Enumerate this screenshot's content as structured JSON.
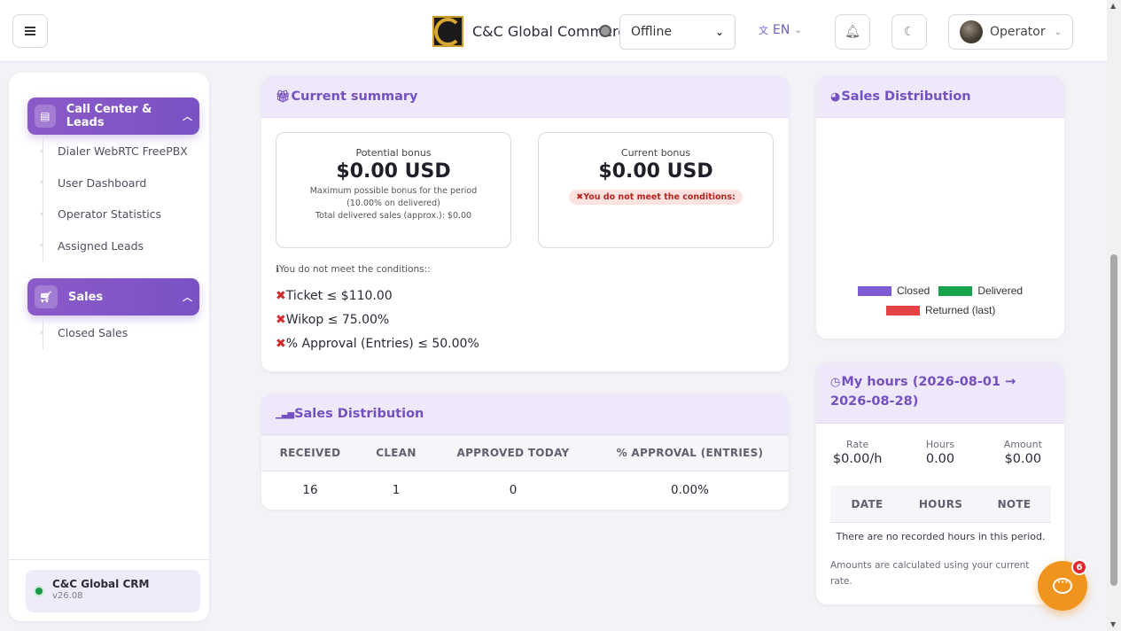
{
  "header": {
    "menu_icon": "hamburger-icon",
    "brand_name": "C&C Global Commerce FZ LLC",
    "status_select_value": "Offline",
    "language": "EN",
    "language_icon": "translate-icon",
    "notifications_icon": "bell-icon",
    "theme_icon": "moon-icon",
    "user_name": "Operator"
  },
  "sidebar": {
    "sections": [
      {
        "title": "Call Center & Leads",
        "icon": "table-icon",
        "items": [
          "Dialer WebRTC FreePBX",
          "User Dashboard",
          "Operator Statistics",
          "Assigned Leads"
        ]
      },
      {
        "title": "Sales",
        "icon": "cart-icon",
        "items": [
          "Closed Sales"
        ]
      }
    ],
    "footer": {
      "name": "C&C Global CRM",
      "version": "v26.08",
      "status_color": "#1c9a4a"
    }
  },
  "summary": {
    "title": "Current summary",
    "title_icon": "gift-icon",
    "potential": {
      "label": "Potential bonus",
      "value": "$0.00 USD",
      "note_line1": "Maximum possible bonus for the period",
      "note_line2": "(10.00% on delivered)",
      "note_line3": "Total delivered sales (approx.): $0.00"
    },
    "current": {
      "label": "Current bonus",
      "value": "$0.00 USD",
      "warning": "You do not meet the conditions:"
    },
    "conditions_title": "You do not meet the conditions::",
    "conditions": [
      "Ticket ≤ $110.00",
      "Wikop ≤ 75.00%",
      "% Approval (Entries) ≤ 50.00%"
    ]
  },
  "distribution_table": {
    "title": "Sales Distribution",
    "title_icon": "bar-chart-icon",
    "columns": [
      "RECEIVED",
      "CLEAN",
      "APPROVED TODAY",
      "% APPROVAL (ENTRIES)"
    ],
    "row": [
      "16",
      "1",
      "0",
      "0.00%"
    ]
  },
  "distribution_chart": {
    "title": "Sales Distribution",
    "title_icon": "pie-chart-icon",
    "legend": [
      {
        "label": "Closed",
        "color": "#7e5bd0"
      },
      {
        "label": "Delivered",
        "color": "#16a34a"
      },
      {
        "label": "Returned (last)",
        "color": "#e54343"
      }
    ]
  },
  "hours": {
    "title": "My hours (2026-08-01 → 2026-08-28)",
    "title_icon": "clock-icon",
    "stats": [
      {
        "label": "Rate",
        "value": "$0.00/h"
      },
      {
        "label": "Hours",
        "value": "0.00"
      },
      {
        "label": "Amount",
        "value": "$0.00"
      }
    ],
    "columns": [
      "DATE",
      "HOURS",
      "NOTE"
    ],
    "empty_message": "There are no recorded hours in this period.",
    "note": "Amounts are calculated using your current rate."
  },
  "chat": {
    "badge_count": "6"
  }
}
